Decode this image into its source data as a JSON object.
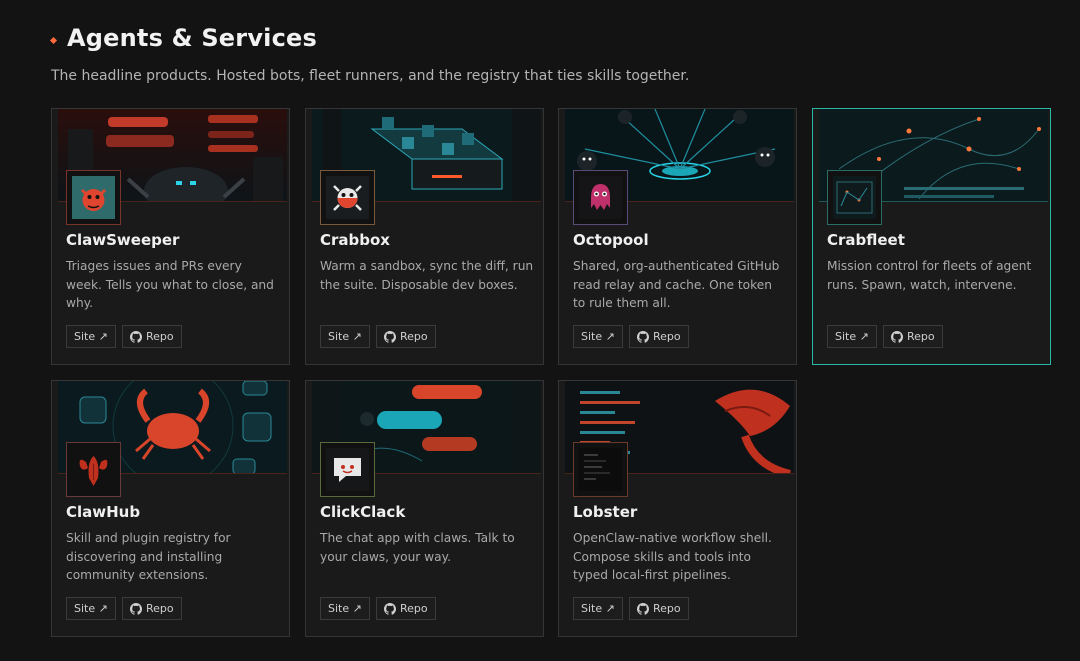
{
  "section": {
    "title": "Agents & Services",
    "subtitle": "The headline products. Hosted bots, fleet runners, and the registry that ties skills together."
  },
  "colors": {
    "accent": "#ff6a3d",
    "active_border": "#2bb7a5",
    "background": "#131313",
    "card": "#1a1a1a"
  },
  "cards": [
    {
      "name": "ClawSweeper",
      "desc": "Triages issues and PRs every week. Tells you what to close, and why.",
      "site_label": "Site ↗",
      "repo_label": "Repo",
      "logo_icon": "red-crab-icon",
      "active": false
    },
    {
      "name": "Crabbox",
      "desc": "Warm a sandbox, sync the diff, run the suite. Disposable dev boxes.",
      "site_label": "Site ↗",
      "repo_label": "Repo",
      "logo_icon": "crab-face-icon",
      "active": false
    },
    {
      "name": "Octopool",
      "desc": "Shared, org-authenticated GitHub read relay and cache. One token to rule them all.",
      "site_label": "Site ↗",
      "repo_label": "Repo",
      "logo_icon": "octopus-icon",
      "active": false
    },
    {
      "name": "Crabfleet",
      "desc": "Mission control for fleets of agent runs. Spawn, watch, intervene.",
      "site_label": "Site ↗",
      "repo_label": "Repo",
      "logo_icon": "dashboard-icon",
      "active": true
    },
    {
      "name": "ClawHub",
      "desc": "Skill and plugin registry for discovering and installing community extensions.",
      "site_label": "Site ↗",
      "repo_label": "Repo",
      "logo_icon": "lobster-icon",
      "active": false
    },
    {
      "name": "ClickClack",
      "desc": "The chat app with claws. Talk to your claws, your way.",
      "site_label": "Site ↗",
      "repo_label": "Repo",
      "logo_icon": "chat-crab-icon",
      "active": false
    },
    {
      "name": "Lobster",
      "desc": "OpenClaw-native workflow shell. Compose skills and tools into typed local-first pipelines.",
      "site_label": "Site ↗",
      "repo_label": "Repo",
      "logo_icon": "terminal-icon",
      "active": false
    }
  ]
}
